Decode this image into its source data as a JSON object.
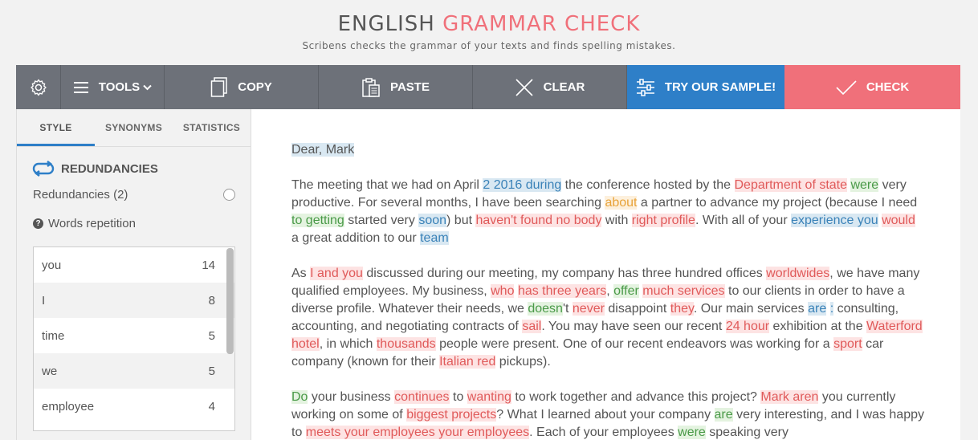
{
  "header": {
    "title_plain": "ENGLISH",
    "title_accent": "GRAMMAR CHECK",
    "subtitle": "Scribens checks the grammar of your texts and finds spelling mistakes."
  },
  "toolbar": {
    "tools_label": "TOOLS",
    "copy_label": "COPY",
    "paste_label": "PASTE",
    "clear_label": "CLEAR",
    "sample_label": "TRY OUR SAMPLE!",
    "check_label": "CHECK"
  },
  "sidebar": {
    "tabs": [
      {
        "label": "STYLE"
      },
      {
        "label": "SYNONYMS"
      },
      {
        "label": "STATISTICS"
      }
    ],
    "section_title": "REDUNDANCIES",
    "redundancies_label": "Redundancies (2)",
    "repetition_label": "Words repetition",
    "words": [
      {
        "word": "you",
        "count": "14"
      },
      {
        "word": "I",
        "count": "8"
      },
      {
        "word": "time",
        "count": "5"
      },
      {
        "word": "we",
        "count": "5"
      },
      {
        "word": "employee",
        "count": "4"
      }
    ]
  },
  "editor": {
    "text": {
      "p0_a": "Dear, Mark",
      "p1_a": "The meeting that we had on April ",
      "p1_b": "2 2016 during",
      "p1_c": " the conference hosted by the ",
      "p1_d": "Department of state",
      "p1_e": " ",
      "p1_f": "were",
      "p1_g": " very productive. For several months, I have been searching ",
      "p1_h": "about",
      "p1_i": " a partner to advance my project (because I need ",
      "p1_j": "to getting",
      "p1_k": " started very ",
      "p1_l": "soon",
      "p1_m": ") but ",
      "p1_n": "haven't found no body",
      "p1_o": " with ",
      "p1_p": "right profile",
      "p1_q": ". With all of your ",
      "p1_r": "experience you",
      "p1_s": " ",
      "p1_t": "would",
      "p1_u": " a great addition to our ",
      "p1_v": "team",
      "p2_a": "As ",
      "p2_b": "I and you",
      "p2_c": " discussed during our meeting, my company has three hundred offices ",
      "p2_d": "worldwides",
      "p2_e": ", we have many qualified employees. My business, ",
      "p2_f": "who",
      "p2_g": " ",
      "p2_h": "has three years",
      "p2_i": ", ",
      "p2_j": "offer",
      "p2_k": " ",
      "p2_l": "much services",
      "p2_m": " to our clients in order to have a diverse profile. Whatever their needs, we ",
      "p2_n": "doesn",
      "p2_o": "'t ",
      "p2_p": "never",
      "p2_q": " disappoint ",
      "p2_r": "they",
      "p2_s": ". Our main services ",
      "p2_t": "are",
      "p2_u": " ",
      "p2_v": ":",
      "p2_w": " consulting, accounting, and negotiating contracts of ",
      "p2_x": "sail",
      "p2_y": ". You may have seen our recent ",
      "p2_z": "24 hour",
      "p2_aa": " exhibition at the ",
      "p2_ab": "Waterford",
      "p2_ac": " ",
      "p2_ad": "hotel",
      "p2_ae": ", in which ",
      "p2_af": "thousands",
      "p2_ag": " people were present. One of our recent endeavors was working for a ",
      "p2_ah": "sport",
      "p2_ai": " car company (known for their ",
      "p2_aj": "Italian red",
      "p2_ak": " pickups).",
      "p3_a": "Do",
      "p3_b": " your business ",
      "p3_c": "continues",
      "p3_d": " to ",
      "p3_e": "wanting",
      "p3_f": " to work together and advance this project? ",
      "p3_g": "Mark aren",
      "p3_h": " you currently working on some of ",
      "p3_i": "biggest projects",
      "p3_j": "? What I learned about your company ",
      "p3_k": "are",
      "p3_l": " very interesting, and I was happy to ",
      "p3_m": "meets your employees your employees",
      "p3_n": ". Each of your employees ",
      "p3_o": "were",
      "p3_p": " speaking very"
    }
  },
  "colors": {
    "toolbar_bg": "#6d7179",
    "sample_bg": "#2e7fc8",
    "check_bg": "#f0707a",
    "accent": "#f0707a",
    "error_red": "#e05a5a",
    "grammar_green": "#4a9a48",
    "style_blue": "#3a82b8",
    "warning_orange": "#e8a33a"
  },
  "icons": {
    "settings": "gear-icon",
    "tools": "hamburger-icon",
    "tools_caret": "chevron-down-icon",
    "copy": "copy-icon",
    "paste": "clipboard-icon",
    "clear": "x-icon",
    "sample": "sliders-icon",
    "check": "checkmark-icon",
    "redundancies": "cycle-arrows-icon",
    "help": "question-icon"
  }
}
